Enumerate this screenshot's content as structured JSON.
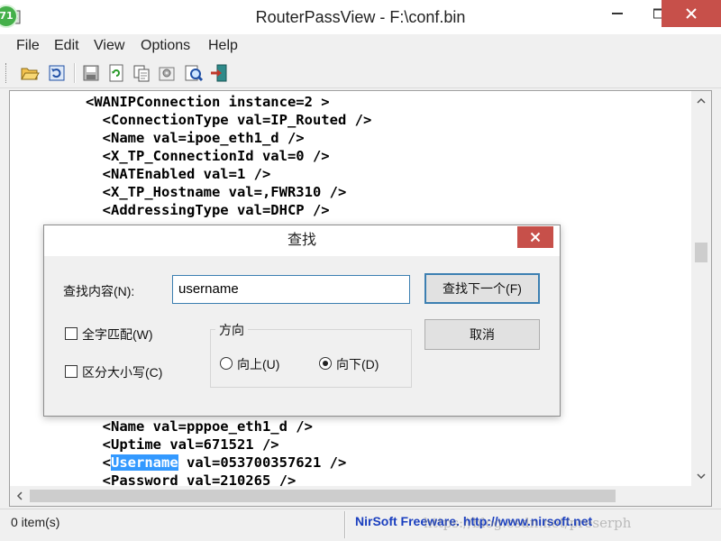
{
  "window": {
    "title": "RouterPassView   -   F:\\conf.bin",
    "badge": "71"
  },
  "menu": [
    "File",
    "Edit",
    "View",
    "Options",
    "Help"
  ],
  "toolbar": {
    "icons": [
      "open-folder-icon",
      "reload-icon",
      "save-icon",
      "refresh-icon",
      "copy-icon",
      "properties-icon",
      "find-icon",
      "exit-icon"
    ]
  },
  "content": {
    "lines_top": [
      "<WANIPConnection instance=2 >",
      "  <ConnectionType val=IP_Routed />",
      "  <Name val=ipoe_eth1_d />",
      "  <X_TP_ConnectionId val=0 />",
      "  <NATEnabled val=1 />",
      "  <X_TP_Hostname val=,FWR310 />",
      "  <AddressingType val=DHCP />"
    ],
    "lines_bottom": [
      "  <Name val=pppoe_eth1_d />",
      "  <Uptime val=671521 />"
    ],
    "username_prefix": "  <",
    "username_highlight": "Username",
    "username_suffix": " val=053700357621 />",
    "partial_line": "  <Password val=210265 />"
  },
  "status": {
    "items": "0 item(s)",
    "credit": "NirSoft Freeware.  http://www.nirsoft.net",
    "watermark": "https://blog.csdn.net/preserph"
  },
  "find_dialog": {
    "title": "查找",
    "find_label": "查找内容(N):",
    "find_value": "username",
    "find_next_button": "查找下一个(F)",
    "cancel_button": "取消",
    "whole_word": "全字匹配(W)",
    "whole_word_checked": false,
    "match_case": "区分大小写(C)",
    "match_case_checked": false,
    "direction_label": "方向",
    "up_label": "向上(U)",
    "down_label": "向下(D)",
    "direction": "down"
  },
  "colors": {
    "close_button": "#c7504a",
    "highlight": "#3399ff",
    "link": "#1a3fbf",
    "badge": "#45b04a"
  }
}
